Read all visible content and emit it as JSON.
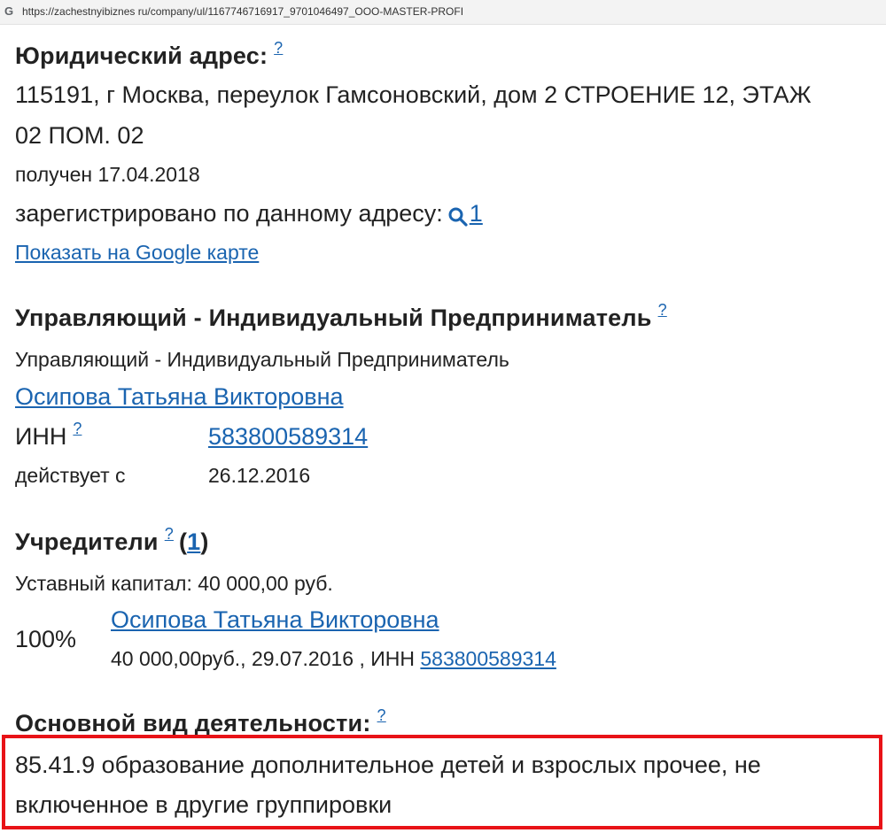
{
  "browser": {
    "favicon": "G",
    "url": "https://zachestnyibiznes ru/company/ul/1167746716917_9701046497_OOO-MASTER-PROFI"
  },
  "legal_address": {
    "heading": "Юридический адрес:",
    "help": "?",
    "line1": "115191, г Москва, переулок Гамсоновский, дом 2 СТРОЕНИЕ 12, ЭТАЖ",
    "line2": "02 ПОМ. 02",
    "received": "получен 17.04.2018",
    "registered_label": "зарегистрировано по данному адресу:",
    "registered_count": "1",
    "map_link": "Показать на Google карте"
  },
  "manager": {
    "heading": "Управляющий - Индивидуальный Предприниматель",
    "help": "?",
    "subtitle": "Управляющий - Индивидуальный Предприниматель",
    "name": "Осипова Татьяна Викторовна",
    "inn_label": "ИНН",
    "inn_help": "?",
    "inn_value": "583800589314",
    "since_label": "действует с",
    "since_value": "26.12.2016"
  },
  "founders": {
    "heading": "Учредители",
    "help": "?",
    "count_open": "(",
    "count": "1",
    "count_close": ")",
    "capital": "Уставный капитал: 40 000,00 руб.",
    "share": "100%",
    "name": "Осипова Татьяна Викторовна",
    "details": "40 000,00руб., 29.07.2016 , ИНН",
    "inn_value": "583800589314"
  },
  "activity": {
    "heading": "Основной вид деятельности:",
    "help": "?",
    "line1": "85.41.9 образование дополнительное детей и взрослых прочее, не",
    "line2": "включенное в другие группировки"
  },
  "colors": {
    "link": "#1a64b0",
    "text": "#222222",
    "highlight": "#e81217"
  }
}
